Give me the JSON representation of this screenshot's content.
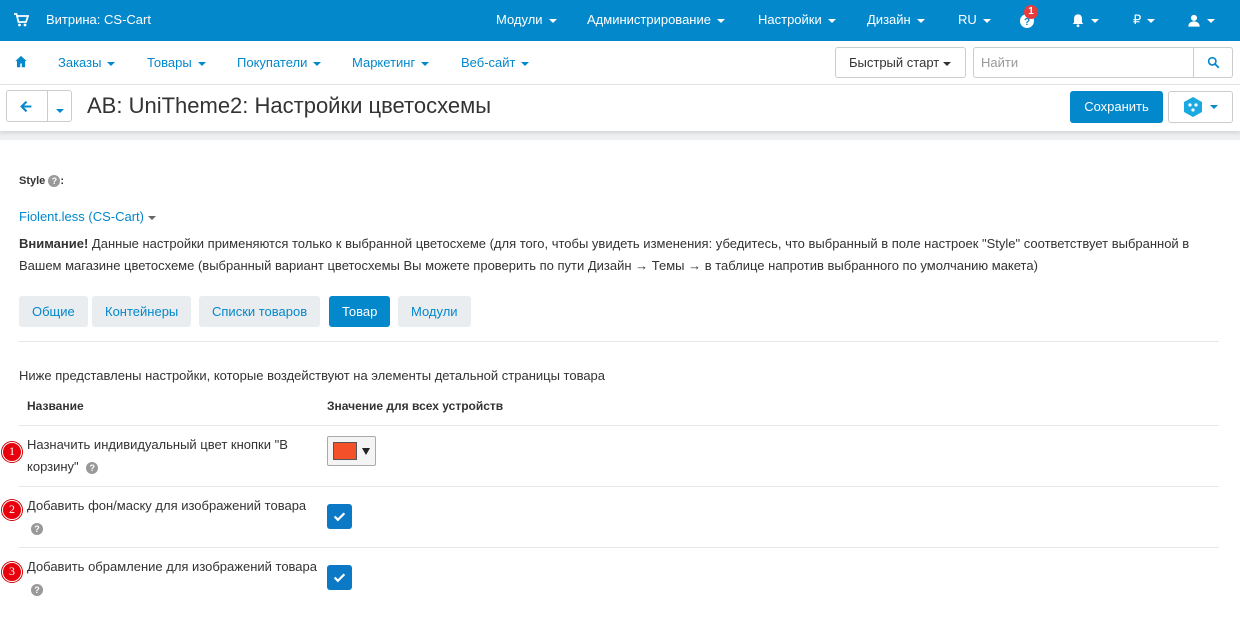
{
  "topbar": {
    "storefront": "Витрина: CS-Cart",
    "menus": [
      "Модули",
      "Администрирование",
      "Настройки",
      "Дизайн",
      "RU"
    ],
    "notification_count": "1",
    "currency": "₽",
    "colors": {
      "bar": "#0388cc"
    }
  },
  "navbar": {
    "items": [
      "Заказы",
      "Товары",
      "Покупатели",
      "Маркетинг",
      "Веб-сайт"
    ],
    "quick_start": "Быстрый старт",
    "search_placeholder": "Найти"
  },
  "titlebar": {
    "title": "AB: UniTheme2: Настройки цветосхемы",
    "save": "Сохранить"
  },
  "content": {
    "style_label": "Style",
    "style_colon": ":",
    "style_value": "Fiolent.less (CS-Cart)",
    "notice_bold": "Внимание!",
    "notice_text": " Данные настройки применяются только к выбранной цветосхеме (для того, чтобы увидеть изменения: убедитесь, что выбранный в поле настроек \"Style\" соответствует выбранной в Вашем магазине цветосхеме (выбранный вариант цветосхемы Вы можете проверить по пути Дизайн → Темы → в таблице напротив выбранного по умолчанию макета)",
    "tabs": [
      "Общие",
      "Контейнеры",
      "Списки товаров",
      "Товар",
      "Модули"
    ],
    "active_tab": "Товар",
    "description": "Ниже представлены настройки, которые воздействуют на элементы детальной страницы товара",
    "col_name": "Название",
    "col_value": "Значение для всех устройств",
    "rows": [
      {
        "num": "1",
        "label": "Назначить индивидуальный цвет кнопки \"В корзину\"",
        "control": "color",
        "color": "#f4512b"
      },
      {
        "num": "2",
        "label": "Добавить фон/маску для изображений товара",
        "control": "checkbox",
        "checked": true
      },
      {
        "num": "3",
        "label": "Добавить обрамление для изображений товара",
        "control": "checkbox",
        "checked": true
      }
    ]
  }
}
